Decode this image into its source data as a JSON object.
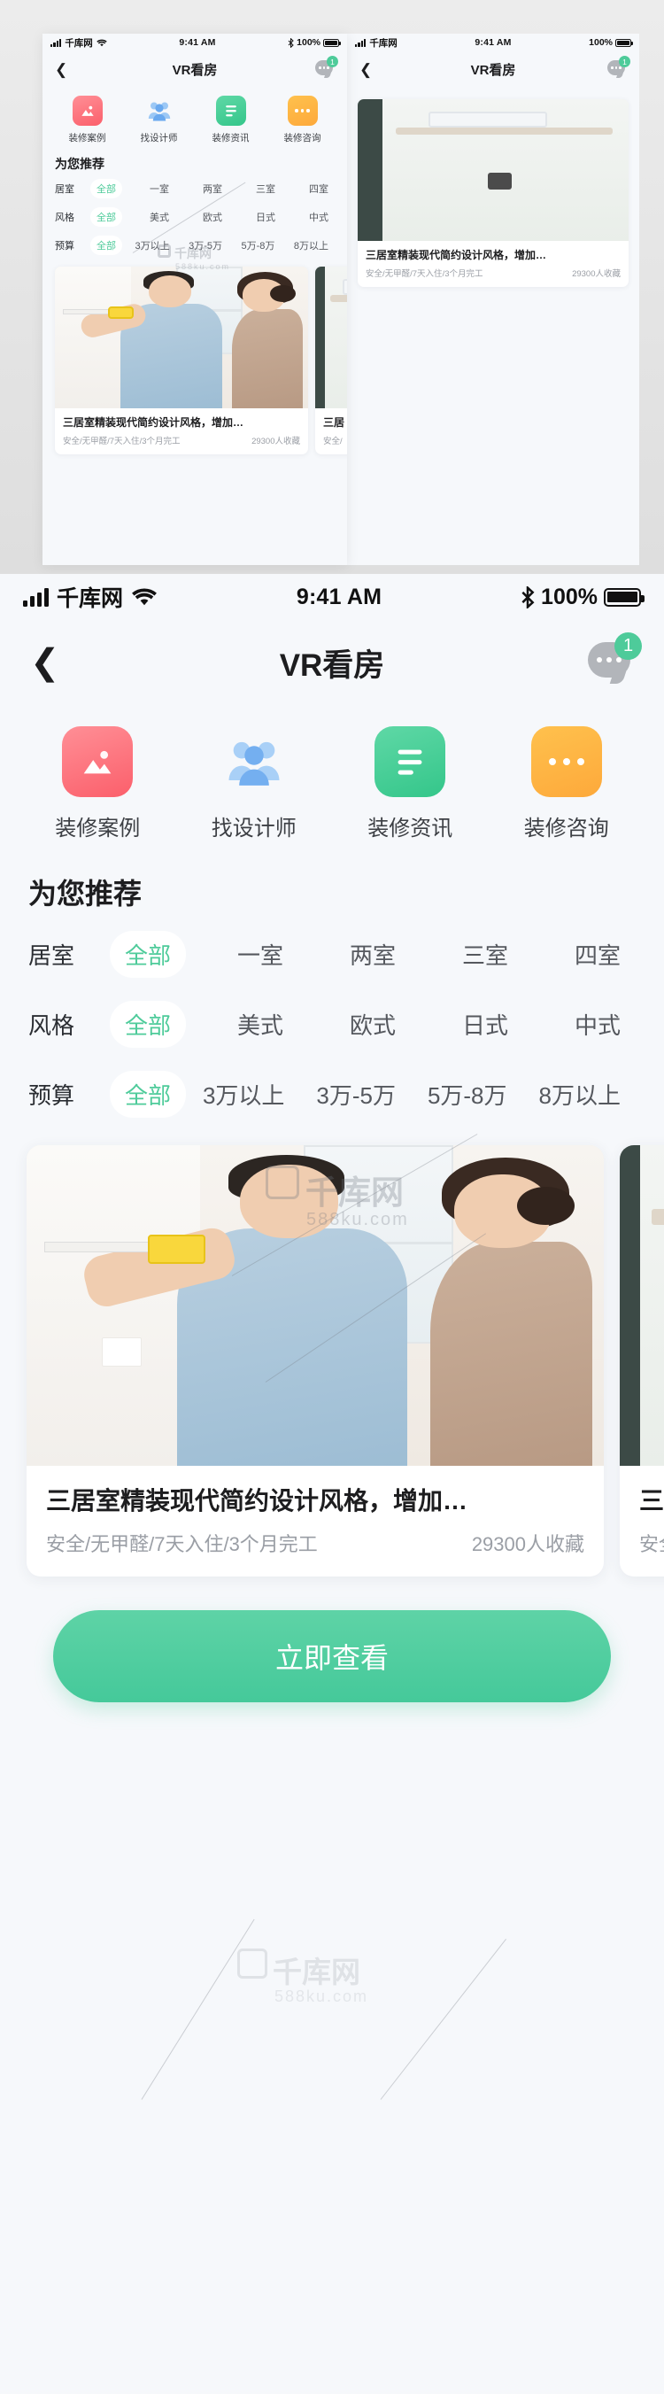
{
  "status_bar": {
    "carrier": "千库网",
    "time": "9:41 AM",
    "battery_percent": "100%",
    "signal_icon": "signal-bars-icon",
    "wifi_icon": "wifi-icon",
    "bluetooth_icon": "bluetooth-icon",
    "battery_icon": "battery-icon"
  },
  "nav": {
    "back_icon": "chevron-left-icon",
    "title": "VR看房",
    "chat_icon": "chat-bubble-icon",
    "badge_count": "1"
  },
  "quick_actions": [
    {
      "label": "装修案例",
      "icon": "image-icon",
      "color": "#fb5f6b"
    },
    {
      "label": "找设计师",
      "icon": "people-icon",
      "color": "#7fb6f0"
    },
    {
      "label": "装修资讯",
      "icon": "document-icon",
      "color": "#34c68a"
    },
    {
      "label": "装修咨询",
      "icon": "chat-dots-icon",
      "color": "#fda93b"
    }
  ],
  "section": {
    "title": "为您推荐"
  },
  "filters": [
    {
      "key": "居室",
      "options": [
        "全部",
        "一室",
        "两室",
        "三室",
        "四室"
      ],
      "selected": "全部"
    },
    {
      "key": "风格",
      "options": [
        "全部",
        "美式",
        "欧式",
        "日式",
        "中式"
      ],
      "selected": "全部"
    },
    {
      "key": "预算",
      "options": [
        "全部",
        "3万以上",
        "3万-5万",
        "5万-8万",
        "8万以上"
      ],
      "selected": "全部"
    }
  ],
  "cards": [
    {
      "title": "三居室精装现代简约设计风格，增加…",
      "features": "安全/无甲醛/7天入住/3个月完工",
      "favorites": "29300人收藏",
      "image_alt": "couple-measuring-wall-photo"
    },
    {
      "title": "三居",
      "features": "安全/",
      "favorites": "",
      "image_alt": "interior-shelf-photo"
    }
  ],
  "cta": {
    "label": "立即查看"
  },
  "watermark": {
    "brand": "千库网",
    "site": "588ku.com",
    "logo": "IC"
  },
  "theme": {
    "accent": "#4ecb9a",
    "page_bg": "#f6f8fb",
    "card_bg": "#ffffff",
    "text_primary": "#1d1d1f",
    "text_secondary": "#9a9ea5"
  }
}
